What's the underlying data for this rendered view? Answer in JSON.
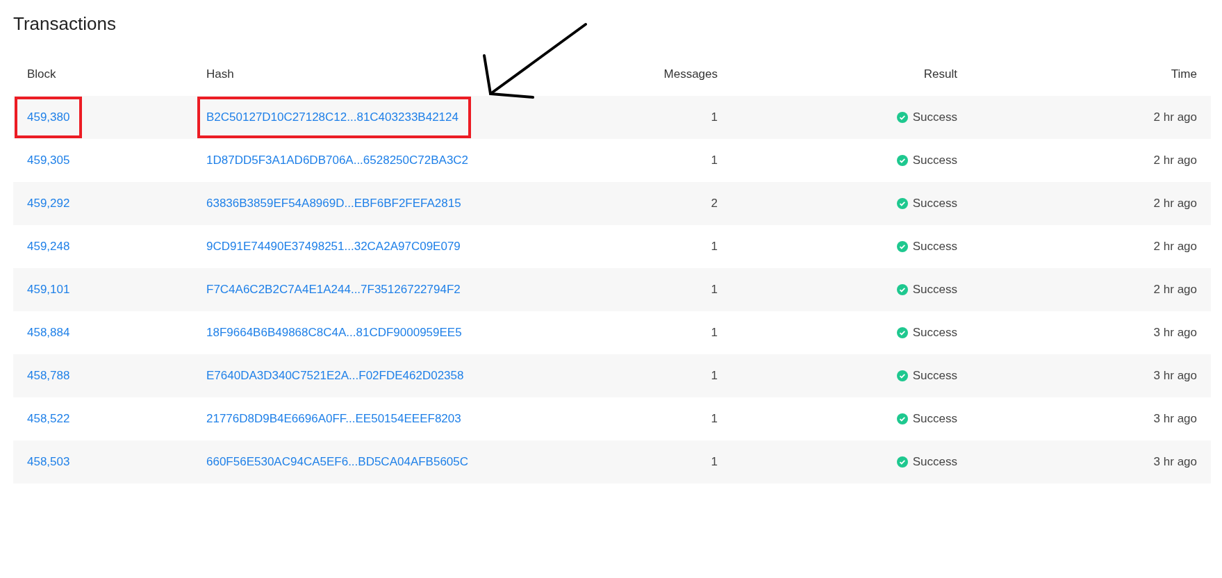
{
  "title": "Transactions",
  "columns": [
    "Block",
    "Hash",
    "Messages",
    "Result",
    "Time"
  ],
  "rows": [
    {
      "block": "459,380",
      "hash": "B2C50127D10C27128C12...81C403233B42124",
      "messages": "1",
      "kind": "success",
      "result": "Success",
      "time": "2 hr ago",
      "highlighted": true
    },
    {
      "block": "459,305",
      "hash": "1D87DD5F3A1AD6DB706A...6528250C72BA3C2",
      "messages": "1",
      "kind": "success",
      "result": "Success",
      "time": "2 hr ago",
      "highlighted": false
    },
    {
      "block": "459,292",
      "hash": "63836B3859EF54A8969D...EBF6BF2FEFA2815",
      "messages": "2",
      "kind": "success",
      "result": "Success",
      "time": "2 hr ago",
      "highlighted": false
    },
    {
      "block": "459,248",
      "hash": "9CD91E74490E37498251...32CA2A97C09E079",
      "messages": "1",
      "kind": "success",
      "result": "Success",
      "time": "2 hr ago",
      "highlighted": false
    },
    {
      "block": "459,101",
      "hash": "F7C4A6C2B2C7A4E1A244...7F35126722794F2",
      "messages": "1",
      "kind": "success",
      "result": "Success",
      "time": "2 hr ago",
      "highlighted": false
    },
    {
      "block": "458,884",
      "hash": "18F9664B6B49868C8C4A...81CDF9000959EE5",
      "messages": "1",
      "kind": "success",
      "result": "Success",
      "time": "3 hr ago",
      "highlighted": false
    },
    {
      "block": "458,788",
      "hash": "E7640DA3D340C7521E2A...F02FDE462D02358",
      "messages": "1",
      "kind": "success",
      "result": "Success",
      "time": "3 hr ago",
      "highlighted": false
    },
    {
      "block": "458,522",
      "hash": "21776D8D9B4E6696A0FF...EE50154EEEF8203",
      "messages": "1",
      "kind": "success",
      "result": "Success",
      "time": "3 hr ago",
      "highlighted": false
    },
    {
      "block": "458,503",
      "hash": "660F56E530AC94CA5EF6...BD5CA04AFB5605C",
      "messages": "1",
      "kind": "success",
      "result": "Success",
      "time": "3 hr ago",
      "highlighted": false
    }
  ]
}
